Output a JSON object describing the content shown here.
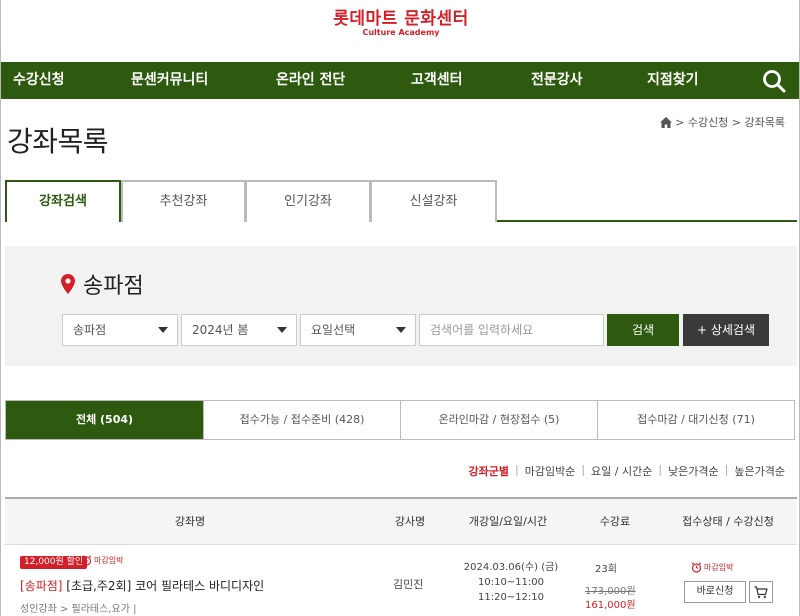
{
  "header": {
    "logo_main": "롯데마트 문화센터",
    "logo_sub": "Culture Academy"
  },
  "nav": {
    "items": [
      "수강신청",
      "문센커뮤니티",
      "온라인 전단",
      "고객센터",
      "전문강사",
      "지점찾기"
    ],
    "search_icon": "search-icon"
  },
  "breadcrumb": {
    "home_icon": "home-icon",
    "text": "> 수강신청 > 강좌목록"
  },
  "page": {
    "title": "강좌목록"
  },
  "tabs": [
    {
      "label": "강좌검색",
      "active": true
    },
    {
      "label": "추천강좌",
      "active": false
    },
    {
      "label": "인기강좌",
      "active": false
    },
    {
      "label": "신설강좌",
      "active": false
    }
  ],
  "search": {
    "branch_title": "송파점",
    "branch_select": "송파점",
    "term_select": "2024년 봄",
    "day_select": "요일선택",
    "keyword_placeholder": "검색어를 입력하세요",
    "search_label": "검색",
    "detail_label": "+ 상세검색"
  },
  "filters": [
    {
      "label": "전체 (504)",
      "active": true
    },
    {
      "label": "접수가능 / 접수준비 (428)",
      "active": false
    },
    {
      "label": "온라인마감 / 현장접수 (5)",
      "active": false
    },
    {
      "label": "접수마감 / 대기신청 (71)",
      "active": false
    }
  ],
  "sorts": [
    {
      "label": "강좌군별",
      "active": true
    },
    {
      "label": "마감임박순",
      "active": false
    },
    {
      "label": "요일 / 시간순",
      "active": false
    },
    {
      "label": "낮은가격순",
      "active": false
    },
    {
      "label": "높은가격순",
      "active": false
    }
  ],
  "table": {
    "headers": [
      "강좌명",
      "강사명",
      "개강일/요일/시간",
      "수강료",
      "접수상태 / 수강신청"
    ],
    "rows": [
      {
        "discount_badge": "12,000원 할인",
        "deadline_badge": "마감임박",
        "branch_tag": "[송파점]",
        "title": " [초급,주2회] 코어 필라테스 바디디자인",
        "category": "성인강좌 > 필라테스,요가  |",
        "teacher": "김민진",
        "start_date": "2024.03.06(수) (금)",
        "time1": "10:10~11:00",
        "time2": "11:20~12:10",
        "count": "23회",
        "price_original": "173,000원",
        "price_sale": "161,000원",
        "status_badge": "마감임박",
        "apply_label": "바로신청"
      }
    ]
  },
  "colors": {
    "brand_green": "#2d5a0e",
    "brand_red": "#d21f28"
  }
}
